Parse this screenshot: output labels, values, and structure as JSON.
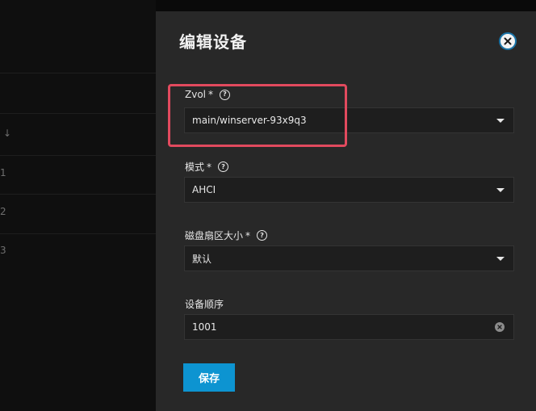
{
  "panel": {
    "title": "编辑设备",
    "close_icon": "close-icon"
  },
  "background": {
    "row_labels": [
      "↓",
      "1",
      "2",
      "3"
    ]
  },
  "fields": {
    "zvol": {
      "label": "Zvol",
      "required_mark": "*",
      "help_icon": "?",
      "value": "main/winserver-93x9q3"
    },
    "mode": {
      "label": "模式",
      "required_mark": "*",
      "help_icon": "?",
      "value": "AHCI"
    },
    "sector_size": {
      "label": "磁盘扇区大小",
      "required_mark": "*",
      "help_icon": "?",
      "value": "默认"
    },
    "device_order": {
      "label": "设备顺序",
      "value": "1001"
    }
  },
  "actions": {
    "save_label": "保存"
  },
  "colors": {
    "panel_bg": "#282828",
    "accent": "#0d94d1",
    "highlight": "#e24a5e"
  }
}
